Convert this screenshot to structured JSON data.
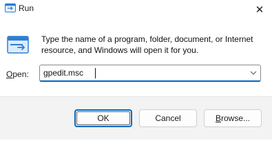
{
  "window": {
    "title": "Run",
    "close_glyph": "✕"
  },
  "dialog": {
    "description": "Type the name of a program, folder, document, or Internet resource, and Windows will open it for you.",
    "open_label_mnemonic": "O",
    "open_label_rest": "pen:",
    "input_value": "gpedit.msc"
  },
  "buttons": {
    "ok": "OK",
    "cancel": "Cancel",
    "browse_mnemonic": "B",
    "browse_rest": "rowse..."
  },
  "icons": {
    "app": "run-app-icon",
    "dialog": "run-dialog-icon",
    "dropdown": "chevron-down-icon",
    "close": "close-icon"
  },
  "colors": {
    "accent": "#0067c0",
    "footer_bg": "#f3f3f3"
  }
}
